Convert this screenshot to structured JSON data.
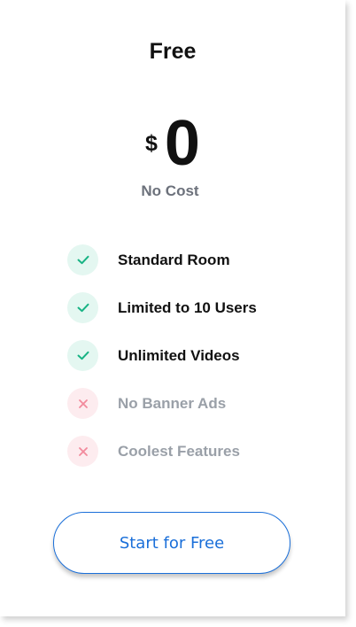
{
  "plan": {
    "title": "Free",
    "currency": "$",
    "amount": "0",
    "subtitle": "No Cost"
  },
  "features": [
    {
      "label": "Standard Room",
      "included": true,
      "icon": "check-icon"
    },
    {
      "label": "Limited to 10 Users",
      "included": true,
      "icon": "check-icon"
    },
    {
      "label": "Unlimited Videos",
      "included": true,
      "icon": "check-icon"
    },
    {
      "label": "No Banner Ads",
      "included": false,
      "icon": "cross-icon"
    },
    {
      "label": "Coolest Features",
      "included": false,
      "icon": "cross-icon"
    }
  ],
  "cta": {
    "label": "Start for Free"
  },
  "colors": {
    "accent": "#1a6fd9",
    "included_icon": "#17b384",
    "excluded_icon": "#f28a9c",
    "muted_text": "#9aa0a8"
  }
}
